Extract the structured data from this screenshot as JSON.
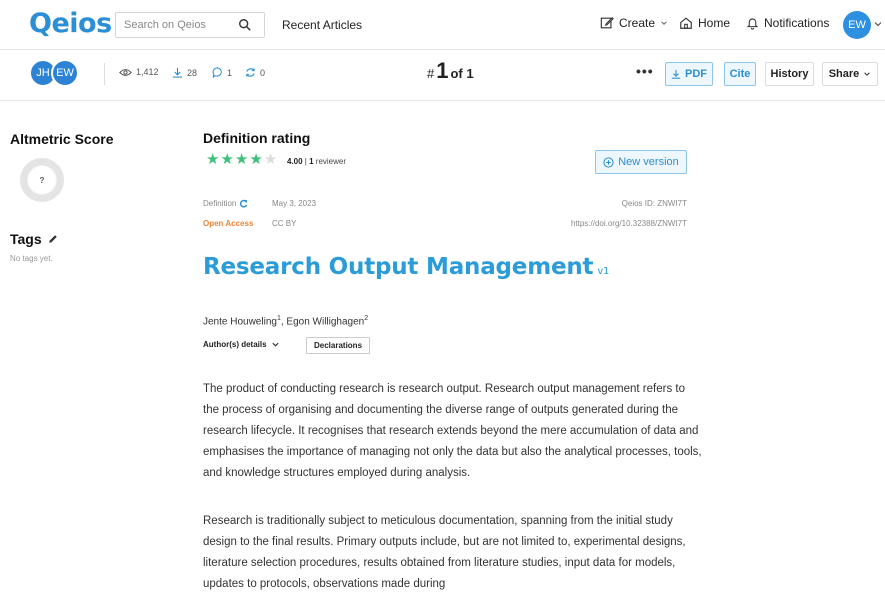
{
  "nav": {
    "logo": "Qeios",
    "search_placeholder": "Search on Qeios",
    "recent": "Recent Articles",
    "create": "Create",
    "home": "Home",
    "notifications": "Notifications",
    "user_initials": "EW"
  },
  "subbar": {
    "authors": [
      "JH",
      "EW"
    ],
    "views": "1,412",
    "downloads": "28",
    "comments": "1",
    "shares": "0",
    "rank_hash": "#",
    "rank_num": "1",
    "rank_of": "of 1",
    "dots": "•••",
    "pdf": "PDF",
    "cite": "Cite",
    "history": "History",
    "share": "Share"
  },
  "sidebar": {
    "altmetric_title": "Altmetric Score",
    "altmetric_value": "?",
    "tags_title": "Tags",
    "tags_empty": "No tags yet."
  },
  "article": {
    "rating_title": "Definition rating",
    "stars_filled": 4,
    "stars_total": 5,
    "rating_value": "4.00",
    "rating_sep": " | ",
    "reviewers": "1",
    "reviewers_label": " reviewer",
    "new_version": "New version",
    "type": "Definition",
    "date": "May 3, 2023",
    "access": "Open Access",
    "license": "CC BY",
    "qeios_id": "Qeios ID: ZNWI7T",
    "doi": "https://doi.org/10.32388/ZNWI7T",
    "title": "Research Output Management",
    "version": "v1",
    "author1": "Jente Houweling",
    "author1_sup": "1",
    "author_sep": ", ",
    "author2": "Egon Willighagen",
    "author2_sup": "2",
    "author_details": "Author(s) details",
    "declarations": "Declarations",
    "paragraph1": "The product of conducting research is research output. Research output management refers to the process of organising and documenting the diverse range of outputs generated during the research lifecycle. It recognises that research extends beyond the mere accumulation of data and emphasises the importance of managing not only the data but also the analytical processes, tools, and knowledge structures employed during analysis.",
    "paragraph2": "Research is traditionally subject to meticulous documentation, spanning from the initial study design to the final results. Primary outputs include, but are not limited to, experimental designs, literature selection procedures, results obtained from literature studies, input data for models, updates to protocols, observations made during"
  },
  "colors": {
    "brand": "#2b8fd6",
    "star": "#3cc07a",
    "star_empty": "#dcdcdc",
    "open_access": "#e8853a",
    "meta_grey": "#888888"
  }
}
